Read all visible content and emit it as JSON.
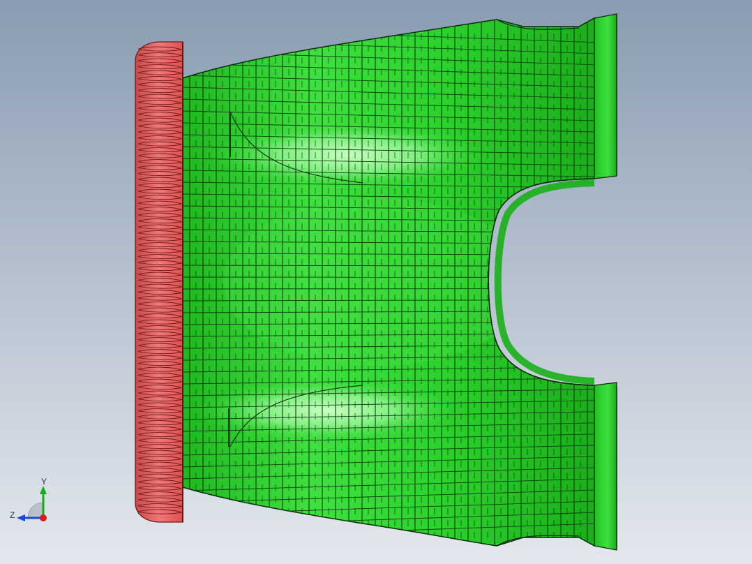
{
  "viewport": {
    "background_top": "#8a9cb2",
    "background_bottom": "#e4e8ee",
    "colors": {
      "body_fill": "#2fd82f",
      "body_highlight": "#b8f7b0",
      "body_shadow": "#159a15",
      "grid_line": "#0c3d0c",
      "flange_fill": "#e06060",
      "flange_line": "#6a1a1a",
      "edge_line": "#0a2a0a"
    },
    "model": {
      "name_icon": "wire-mesh-manifold-icon",
      "flange_icon": "ribbed-flange-icon"
    }
  },
  "triad": {
    "icon": "coordinate-triad-icon",
    "y_label": "Y",
    "z_label": "Z",
    "y_color": "#18a818",
    "z_color": "#1848d8",
    "x_color": "#e01818"
  }
}
